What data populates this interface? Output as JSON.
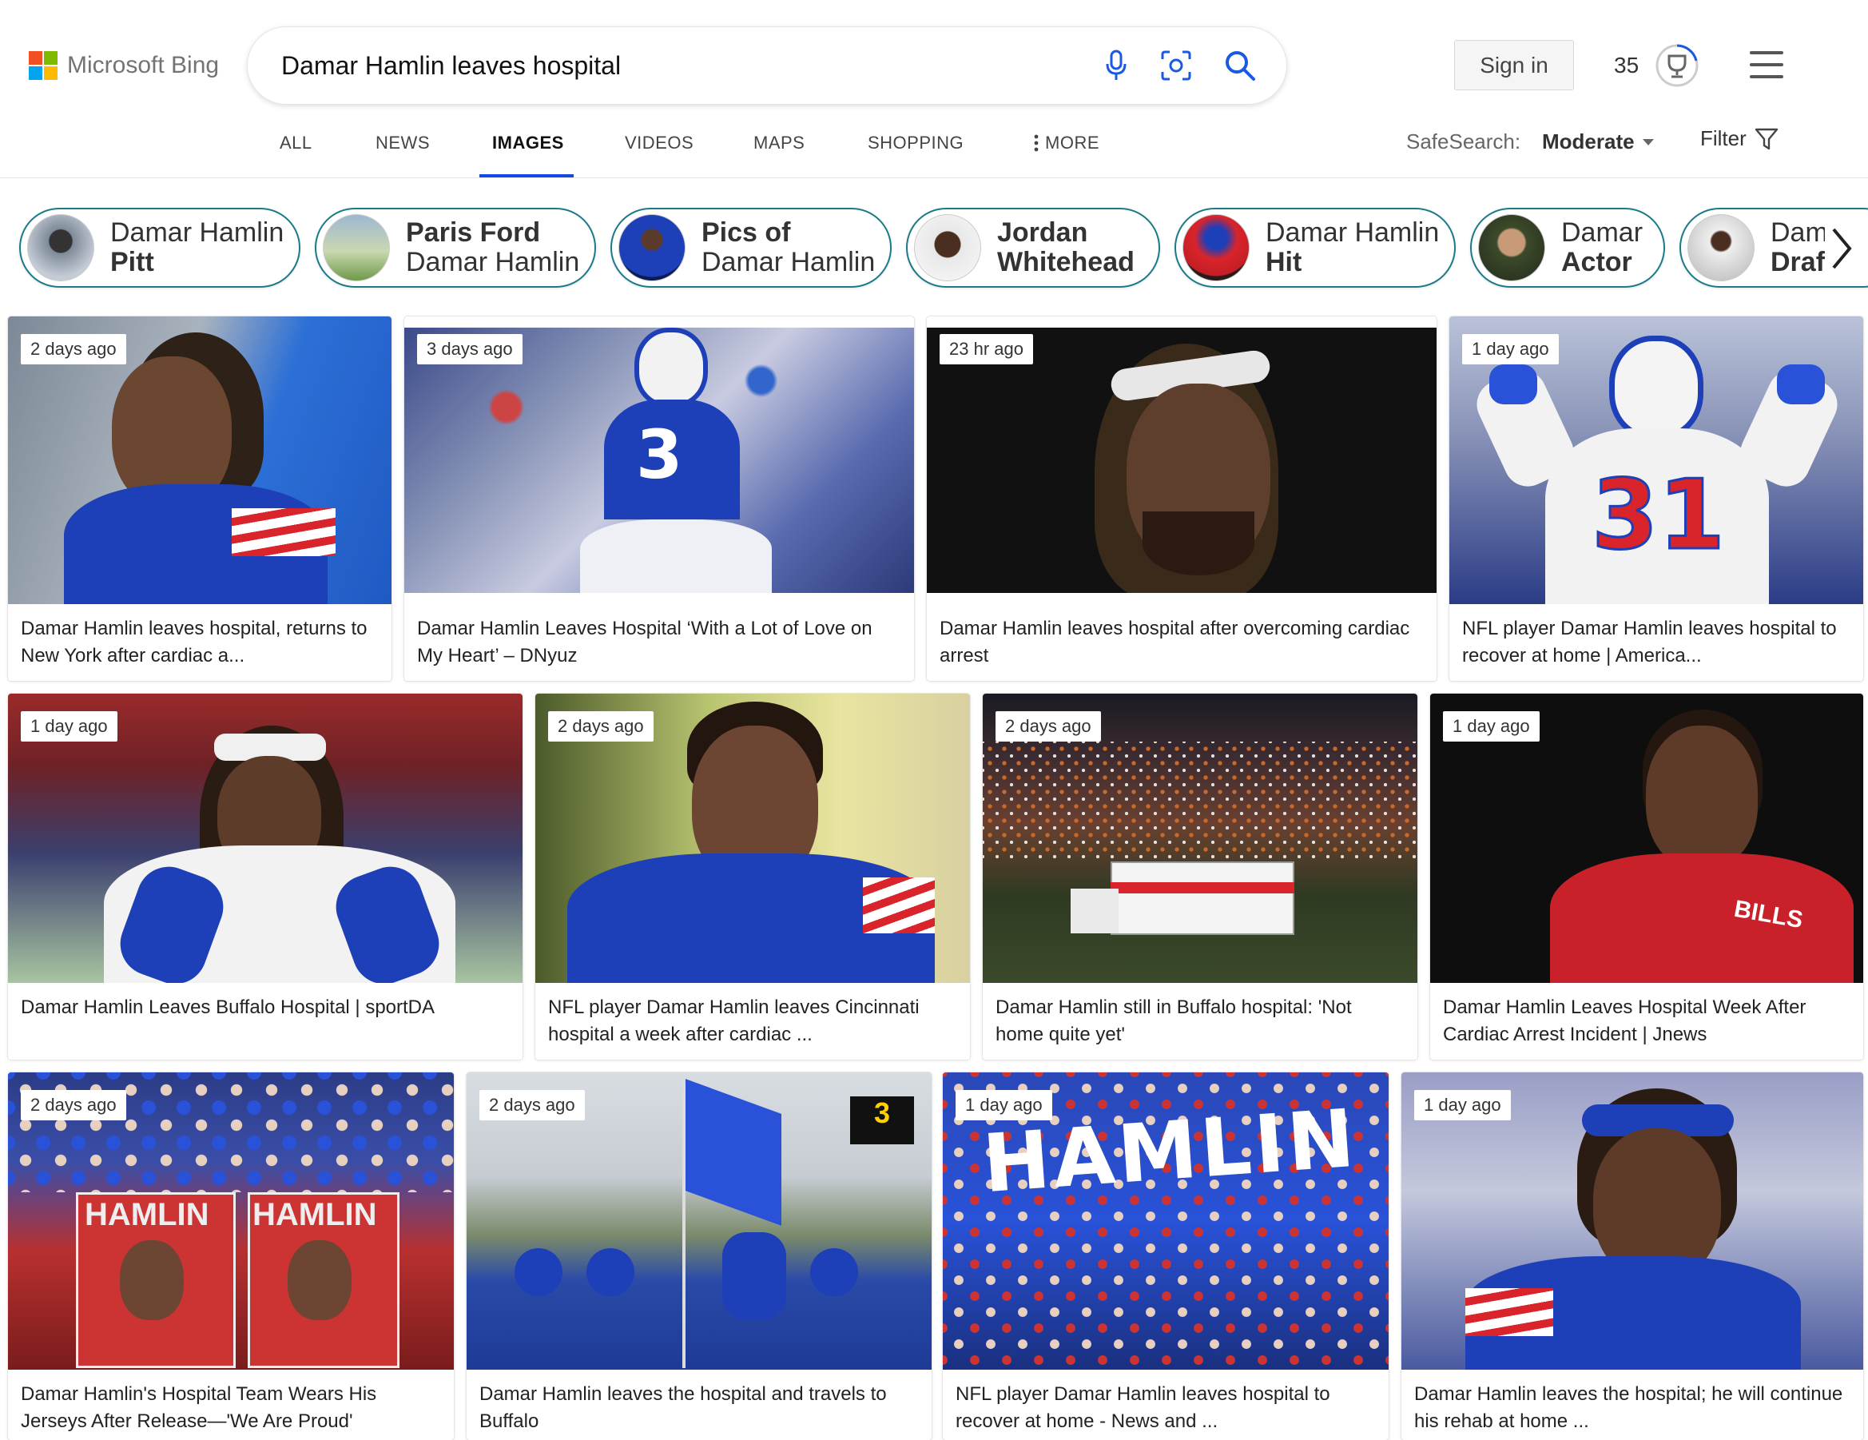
{
  "brand": {
    "name": "Microsoft Bing"
  },
  "search": {
    "query": "Damar Hamlin leaves hospital"
  },
  "header": {
    "sign_in": "Sign in",
    "rewards_count": "35"
  },
  "nav": {
    "tabs": [
      "ALL",
      "NEWS",
      "IMAGES",
      "VIDEOS",
      "MAPS",
      "SHOPPING"
    ],
    "more": "MORE",
    "active": "IMAGES",
    "safesearch_label": "SafeSearch:",
    "safesearch_value": "Moderate",
    "filter": "Filter"
  },
  "related": [
    {
      "l1": "Damar Hamlin",
      "l2": "Pitt",
      "bold": "l2"
    },
    {
      "l1": "Paris Ford",
      "l2": "Damar Hamlin",
      "bold": "l1"
    },
    {
      "l1": "Pics of",
      "l2": "Damar Hamlin",
      "bold": "l1"
    },
    {
      "l1": "Jordan",
      "l2": "Whitehead",
      "bold": "both"
    },
    {
      "l1": "Damar Hamlin",
      "l2": "Hit",
      "bold": "l2"
    },
    {
      "l1": "Damar",
      "l2": "Actor",
      "bold": "l2"
    },
    {
      "l1": "Damar",
      "l2": "Draft",
      "bold": "l2"
    }
  ],
  "results": [
    {
      "age": "2 days ago",
      "caption": "Damar Hamlin leaves hospital, returns to New York after cardiac a..."
    },
    {
      "age": "3 days ago",
      "caption": "Damar Hamlin Leaves Hospital ‘With a Lot of Love on My Heart’ – DNyuz"
    },
    {
      "age": "23 hr ago",
      "caption": "Damar Hamlin leaves hospital after overcoming cardiac arrest"
    },
    {
      "age": "1 day ago",
      "caption": "NFL player Damar Hamlin leaves hospital to recover at home | America..."
    },
    {
      "age": "1 day ago",
      "caption": "Damar Hamlin Leaves Buffalo Hospital | sportDA"
    },
    {
      "age": "2 days ago",
      "caption": "NFL player Damar Hamlin leaves Cincinnati hospital a week after cardiac ..."
    },
    {
      "age": "2 days ago",
      "caption": "Damar Hamlin still in Buffalo hospital: 'Not home quite yet'"
    },
    {
      "age": "1 day ago",
      "caption": "Damar Hamlin Leaves Hospital Week After Cardiac Arrest Incident | Jnews"
    },
    {
      "age": "2 days ago",
      "caption": "Damar Hamlin's Hospital Team Wears His Jerseys After Release—'We Are Proud'"
    },
    {
      "age": "2 days ago",
      "caption": "Damar Hamlin leaves the hospital and travels to Buffalo"
    },
    {
      "age": "1 day ago",
      "caption": "NFL player Damar Hamlin leaves hospital to recover at home - News and ..."
    },
    {
      "age": "1 day ago",
      "caption": "Damar Hamlin leaves the hospital; he will continue his rehab at home ..."
    }
  ],
  "image_text": {
    "jersey_31": "31",
    "jersey_3": "3",
    "bills": "BILLS",
    "sign_hamlin": "HAMLIN",
    "crowd_sign": "HAMLIN"
  },
  "colors": {
    "accent": "#174ae4",
    "chip_border": "#1a7a8a",
    "bills_blue": "#1d3fb8",
    "bills_red": "#d9242b"
  }
}
